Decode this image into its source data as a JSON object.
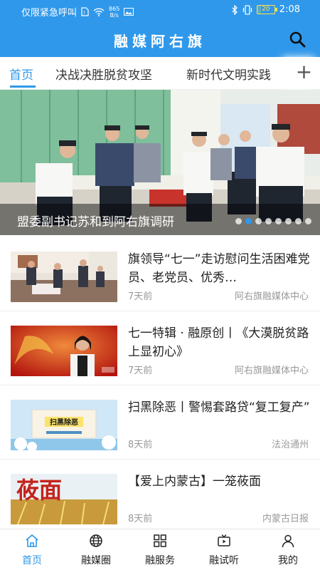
{
  "status_bar": {
    "carrier_text": "仅限紧急呼叫",
    "net_speed_value": "865",
    "net_speed_unit": "B/s",
    "battery": "20",
    "battery_level": 0.2,
    "time": "2:08"
  },
  "header": {
    "title": "融媒阿右旗"
  },
  "tabs": [
    {
      "label": "首页"
    },
    {
      "label": "决战决胜脱贫攻坚"
    },
    {
      "label": "新时代文明实践"
    }
  ],
  "tab_add_symbol": "+",
  "banner": {
    "caption": "盟委副书记苏和到阿右旗调研",
    "slide_count": 8,
    "active_slide": 2
  },
  "news": [
    {
      "title": "旗领导“七一”走访慰问生活困难党员、老党员、优秀…",
      "time": "7天前",
      "source": "阿右旗融媒体中心"
    },
    {
      "title": "七一特辑 · 融原创丨《大漠脱贫路上显初心》",
      "time": "7天前",
      "source": "阿右旗融媒体中心"
    },
    {
      "title": "扫黑除恶丨警惕套路贷“复工复产”",
      "time": "8天前",
      "source": "法治通州"
    },
    {
      "title": "【爱上内蒙古】一笼莜面",
      "time": "8天前",
      "source": "内蒙古日报"
    }
  ],
  "thumb_text": {
    "news3": "扫黑除恶",
    "news4": "莜面"
  },
  "bottom_nav": [
    {
      "label": "首页",
      "icon": "home-icon"
    },
    {
      "label": "融媒圈",
      "icon": "globe-icon"
    },
    {
      "label": "融服务",
      "icon": "grid-icon"
    },
    {
      "label": "融试听",
      "icon": "tv-icon"
    },
    {
      "label": "我的",
      "icon": "user-icon"
    }
  ],
  "colors": {
    "primary": "#2f98ea",
    "battery": "#ffe14d"
  }
}
